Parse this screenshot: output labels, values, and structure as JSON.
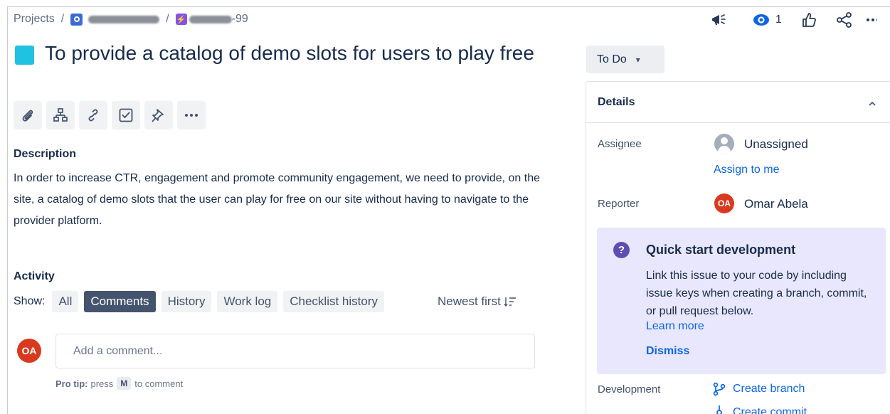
{
  "breadcrumb": {
    "projects_label": "Projects",
    "separator": "/",
    "issue_key_suffix": "-99"
  },
  "header_actions": {
    "watch_count": "1",
    "icons": [
      "megaphone-icon",
      "eye-icon",
      "thumbs-up-icon",
      "share-icon",
      "more-icon"
    ]
  },
  "issue": {
    "type_color": "#1fc2e1",
    "title": "To provide a catalog of demo slots for users to play free",
    "toolbar_icons": [
      "attachment-icon",
      "child-issue-icon",
      "link-icon",
      "checklist-icon",
      "pin-icon",
      "more-icon"
    ],
    "description_heading": "Description",
    "description": "In order to increase CTR, engagement and promote community engagement, we need to provide, on the site, a catalog of demo slots that the user can play for free on our site without having to navigate to the provider platform."
  },
  "activity": {
    "heading": "Activity",
    "show_label": "Show:",
    "filters": [
      {
        "label": "All",
        "active": false
      },
      {
        "label": "Comments",
        "active": true
      },
      {
        "label": "History",
        "active": false
      },
      {
        "label": "Work log",
        "active": false
      },
      {
        "label": "Checklist history",
        "active": false
      }
    ],
    "sort_label": "Newest first",
    "sort_icon": "sort-desc-icon",
    "comment_avatar_initials": "OA",
    "comment_placeholder": "Add a comment...",
    "pro_tip_label": "Pro tip:",
    "pro_tip_press": "press",
    "pro_tip_key": "M",
    "pro_tip_suffix": "to comment"
  },
  "sidebar": {
    "status_label": "To Do",
    "details_heading": "Details",
    "assignee_label": "Assignee",
    "assignee_value": "Unassigned",
    "assign_to_me": "Assign to me",
    "reporter_label": "Reporter",
    "reporter_initials": "OA",
    "reporter_name": "Omar Abela",
    "quick_start": {
      "title": "Quick start development",
      "body": "Link this issue to your code by including issue keys when creating a branch, commit, or pull request below.",
      "learn_more": "Learn more",
      "dismiss": "Dismiss"
    },
    "development_label": "Development",
    "create_branch": "Create branch",
    "create_commit": "Create commit"
  },
  "colors": {
    "accent_link": "#0c66e4",
    "avatar_red": "#d93a1f",
    "quick_start_bg": "#e9e7fd",
    "active_filter": "#44546f"
  }
}
